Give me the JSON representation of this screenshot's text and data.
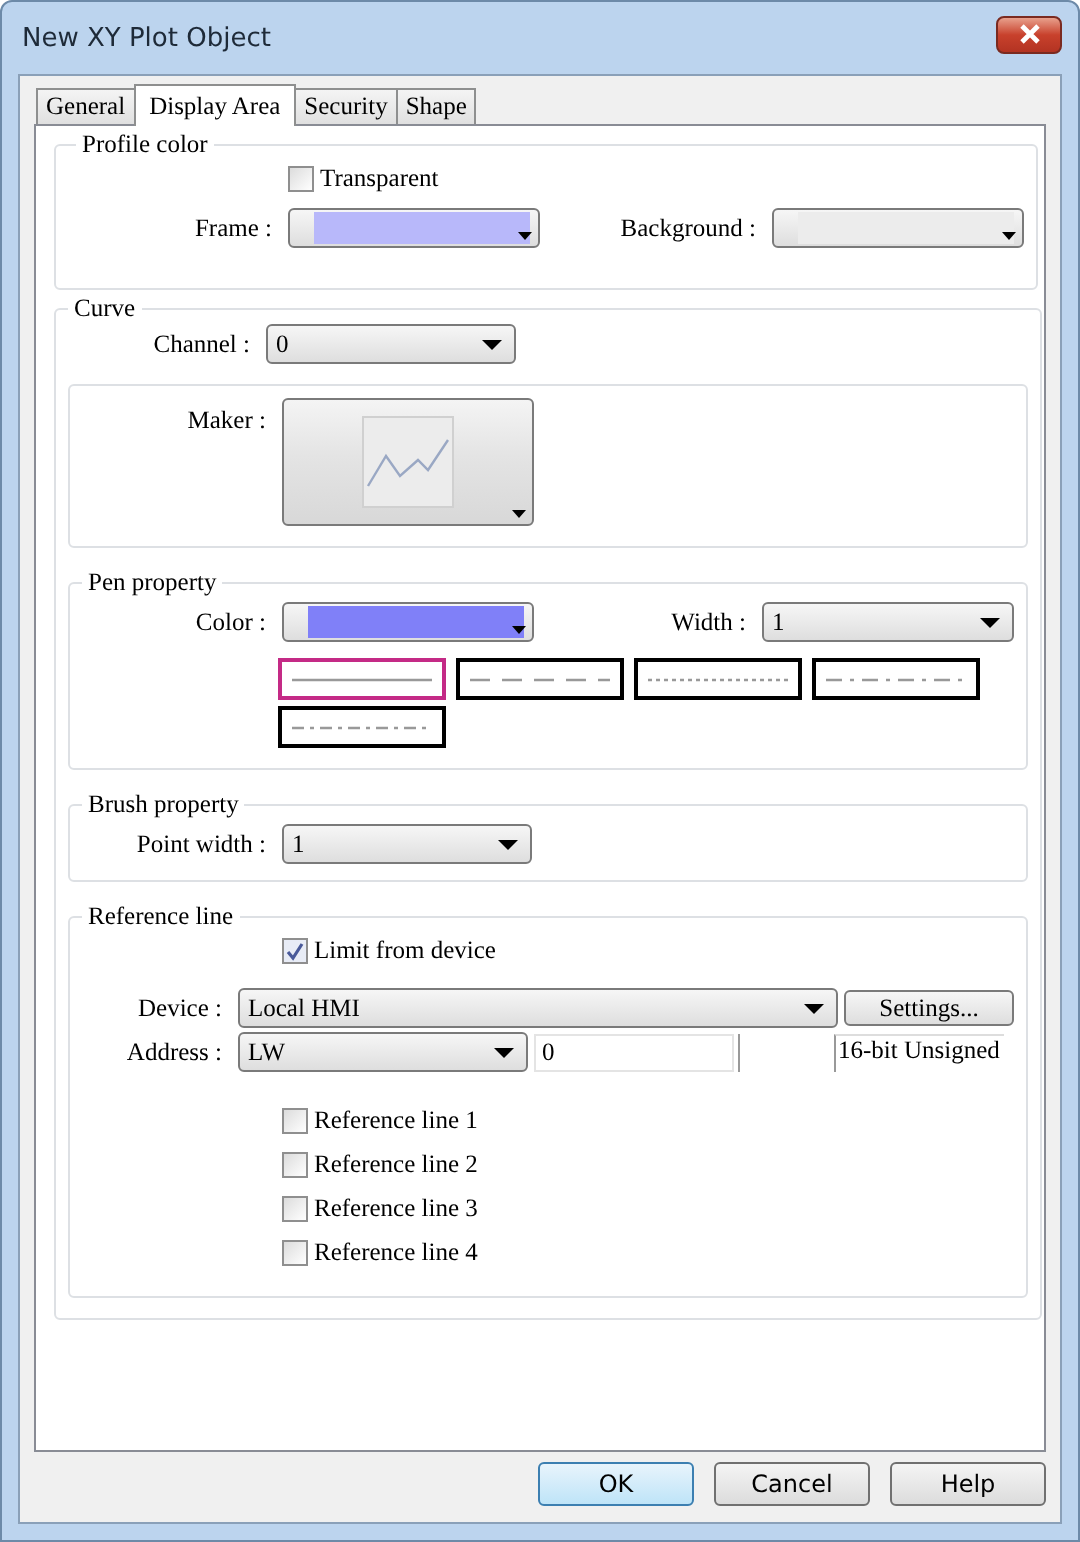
{
  "window": {
    "title": "New XY Plot Object"
  },
  "tabs": [
    {
      "label": "General",
      "selected": false
    },
    {
      "label": "Display Area",
      "selected": true
    },
    {
      "label": "Security",
      "selected": false
    },
    {
      "label": "Shape",
      "selected": false
    }
  ],
  "profile_color": {
    "title": "Profile color",
    "transparent": {
      "label": "Transparent",
      "checked": false
    },
    "frame": {
      "label": "Frame :",
      "color": "#b8b8fa"
    },
    "background": {
      "label": "Background :",
      "color": "#ececec"
    }
  },
  "curve": {
    "title": "Curve",
    "channel": {
      "label": "Channel :",
      "value": "0"
    },
    "maker": {
      "label": "Maker :"
    },
    "pen": {
      "title": "Pen property",
      "color": {
        "label": "Color :",
        "color": "#8080f8"
      },
      "width": {
        "label": "Width :",
        "value": "1"
      },
      "styles": [
        {
          "kind": "solid",
          "selected": true
        },
        {
          "kind": "dash",
          "selected": false
        },
        {
          "kind": "dot",
          "selected": false
        },
        {
          "kind": "dashdot",
          "selected": false
        },
        {
          "kind": "dashdotdot",
          "selected": false
        }
      ]
    },
    "brush": {
      "title": "Brush property",
      "point_width": {
        "label": "Point width :",
        "value": "1"
      }
    },
    "reference": {
      "title": "Reference line",
      "limit": {
        "label": "Limit from device",
        "checked": true
      },
      "device": {
        "label": "Device :",
        "value": "Local HMI",
        "button": "Settings..."
      },
      "address": {
        "label": "Address :",
        "type": "LW",
        "value": "0",
        "format": "16-bit Unsigned"
      },
      "lines": [
        {
          "label": "Reference line 1",
          "checked": false
        },
        {
          "label": "Reference line 2",
          "checked": false
        },
        {
          "label": "Reference line 3",
          "checked": false
        },
        {
          "label": "Reference line 4",
          "checked": false
        }
      ]
    }
  },
  "buttons": [
    {
      "label": "OK",
      "default": true
    },
    {
      "label": "Cancel",
      "default": false
    },
    {
      "label": "Help",
      "default": false
    }
  ]
}
